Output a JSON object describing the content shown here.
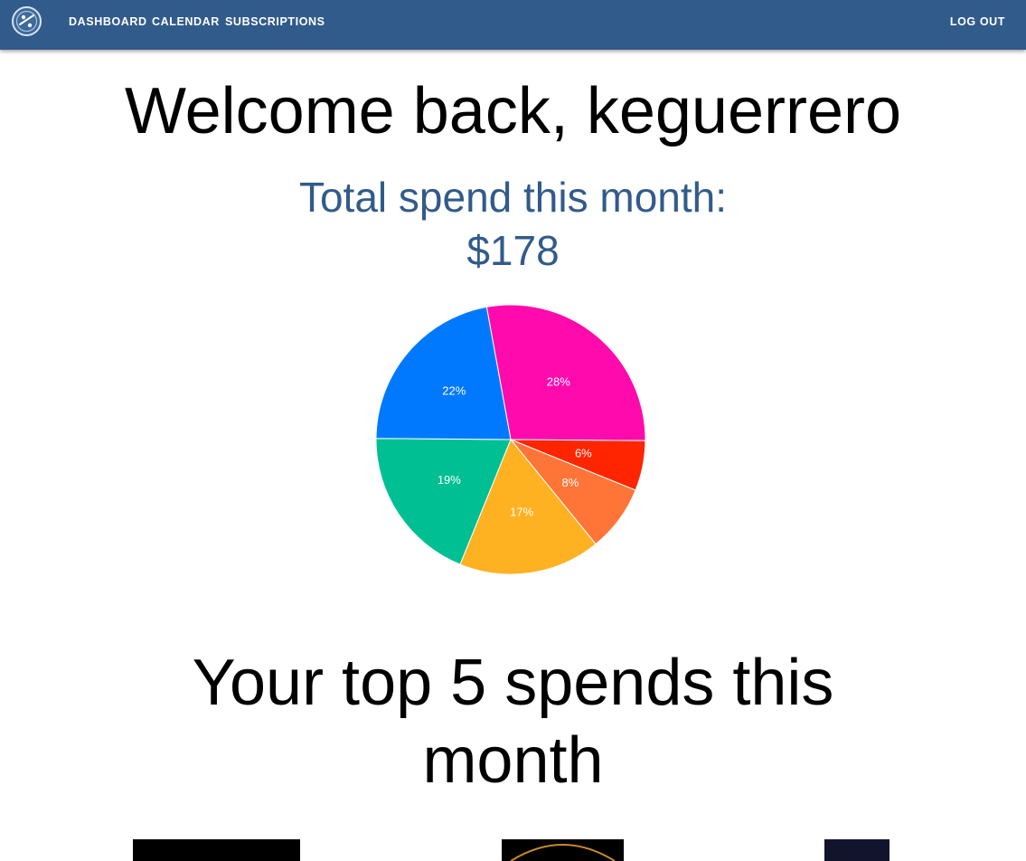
{
  "nav": {
    "logo_icon": "subscription-app-logo-icon",
    "links": [
      "DASHBOARD",
      "CALENDAR",
      "SUBSCRIPTIONS"
    ],
    "logout": "LOG OUT",
    "bar_color": "#315b8a"
  },
  "welcome": {
    "title": "Welcome back, keguerrero"
  },
  "total": {
    "line1": "Total spend this month:",
    "line2": "$178",
    "color": "#315b8a"
  },
  "chart_data": {
    "type": "pie",
    "values": [
      28,
      6,
      8,
      17,
      19,
      22
    ],
    "labels": [
      "28%",
      "6%",
      "8%",
      "17%",
      "19%",
      "22%"
    ],
    "colors": [
      "#ff0aad",
      "#ff2500",
      "#ff7538",
      "#ffb221",
      "#00bf93",
      "#0079ff"
    ]
  },
  "top_spends": {
    "line1": "Your top 5 spends this",
    "line2": "month",
    "thumb_colors": [
      "#000000",
      "#000000",
      "#12142e"
    ]
  }
}
